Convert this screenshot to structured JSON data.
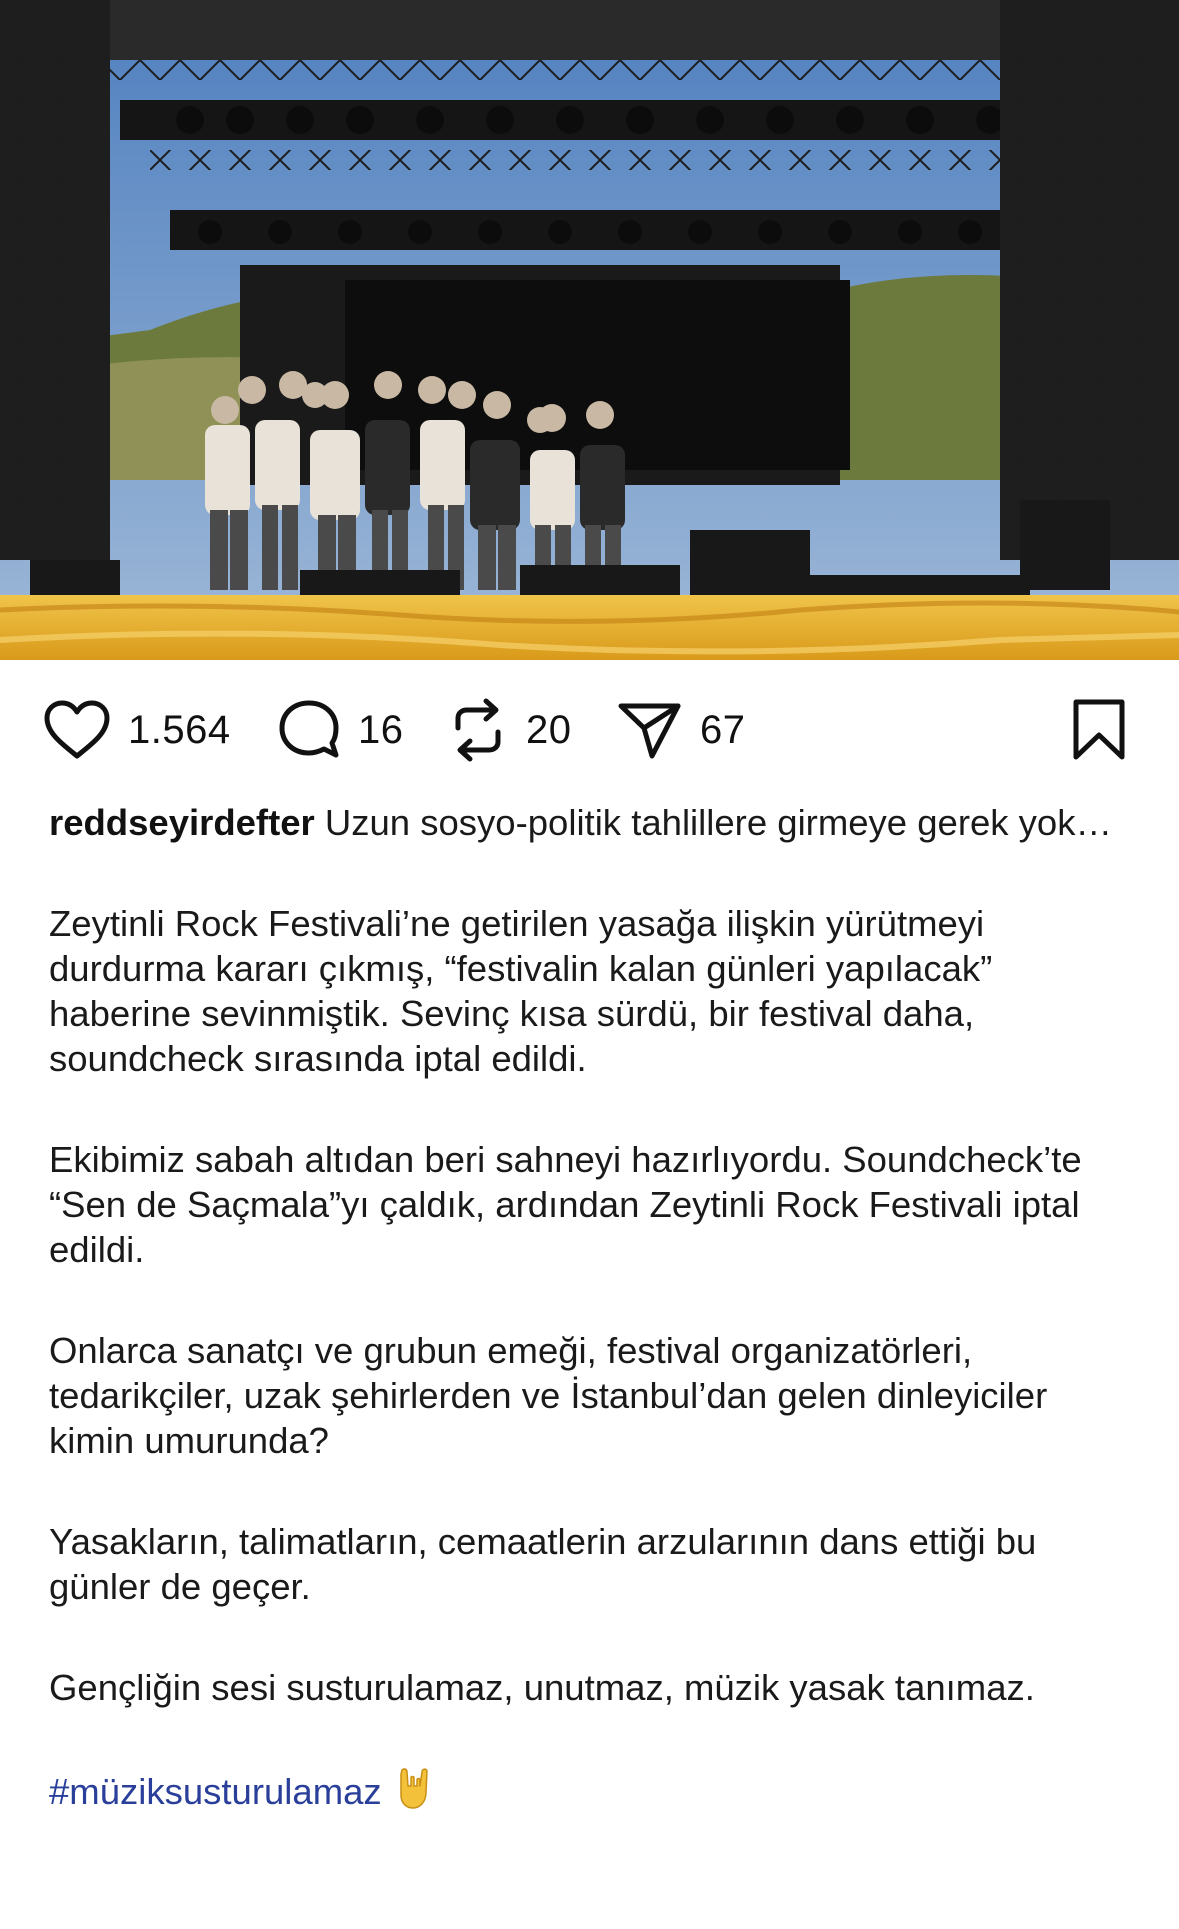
{
  "post": {
    "image_alt": "Band members posing on a festival stage under lighting truss",
    "actions": {
      "likes": "1.564",
      "comments": "16",
      "reposts": "20",
      "shares": "67"
    },
    "icons": {
      "like": "heart-icon",
      "comment": "comment-bubble-icon",
      "repost": "repost-icon",
      "share": "send-icon",
      "save": "bookmark-icon",
      "emoji": "sign-of-the-horns-emoji"
    },
    "caption": {
      "username": "reddseyirdefter",
      "intro": " Uzun sosyo-politik tahlillere girmeye gerek yok…",
      "paragraphs": [
        "Zeytinli Rock Festivali’ne getirilen yasağa ilişkin yürütmeyi durdurma kararı çıkmış, “festivalin kalan günleri yapılacak” haberine sevinmiştik. Sevinç kısa sürdü, bir festival daha, soundcheck sırasında iptal edildi.",
        "Ekibimiz sabah altıdan beri sahneyi hazırlıyordu. Soundcheck’te “Sen de Saçmala”yı çaldık, ardından Zeytinli Rock Festivali iptal edildi.",
        "Onlarca sanatçı ve grubun emeği, festival organizatörleri, tedarikçiler, uzak şehirlerden ve İstanbul’dan gelen dinleyiciler kimin umurunda?",
        "Yasakların, talimatların, cemaatlerin arzularının dans ettiği bu günler de geçer.",
        "Gençliğin sesi susturulamaz, unutmaz, müzik yasak tanımaz."
      ],
      "hashtag": "#müziksusturulamaz"
    },
    "colors": {
      "hashtag": "#2a3f9a",
      "text": "#1a1a1a",
      "stage_floor": "#e8b324"
    }
  }
}
